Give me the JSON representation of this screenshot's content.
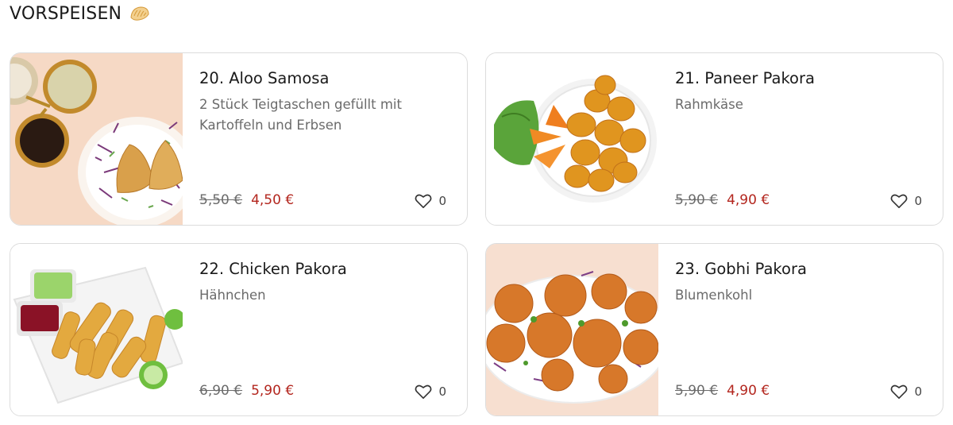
{
  "section": {
    "title": "VORSPEISEN",
    "emoji_icon": "dumpling-icon"
  },
  "items": [
    {
      "title": "20. Aloo Samosa",
      "description": "2 Stück Teigtaschen gefüllt mit Kartoffeln und Erbsen",
      "old_price": "5,50 €",
      "price": "4,50 €",
      "likes": "0"
    },
    {
      "title": "21. Paneer Pakora",
      "description": "Rahmkäse",
      "old_price": "5,90 €",
      "price": "4,90 €",
      "likes": "0"
    },
    {
      "title": "22. Chicken Pakora",
      "description": "Hähnchen",
      "old_price": "6,90 €",
      "price": "5,90 €",
      "likes": "0"
    },
    {
      "title": "23. Gobhi Pakora",
      "description": "Blumenkohl",
      "old_price": "5,90 €",
      "price": "4,90 €",
      "likes": "0"
    }
  ],
  "colors": {
    "price_red": "#b3261e",
    "card_border": "#dcdcdc",
    "muted_text": "#6b6b6b"
  }
}
